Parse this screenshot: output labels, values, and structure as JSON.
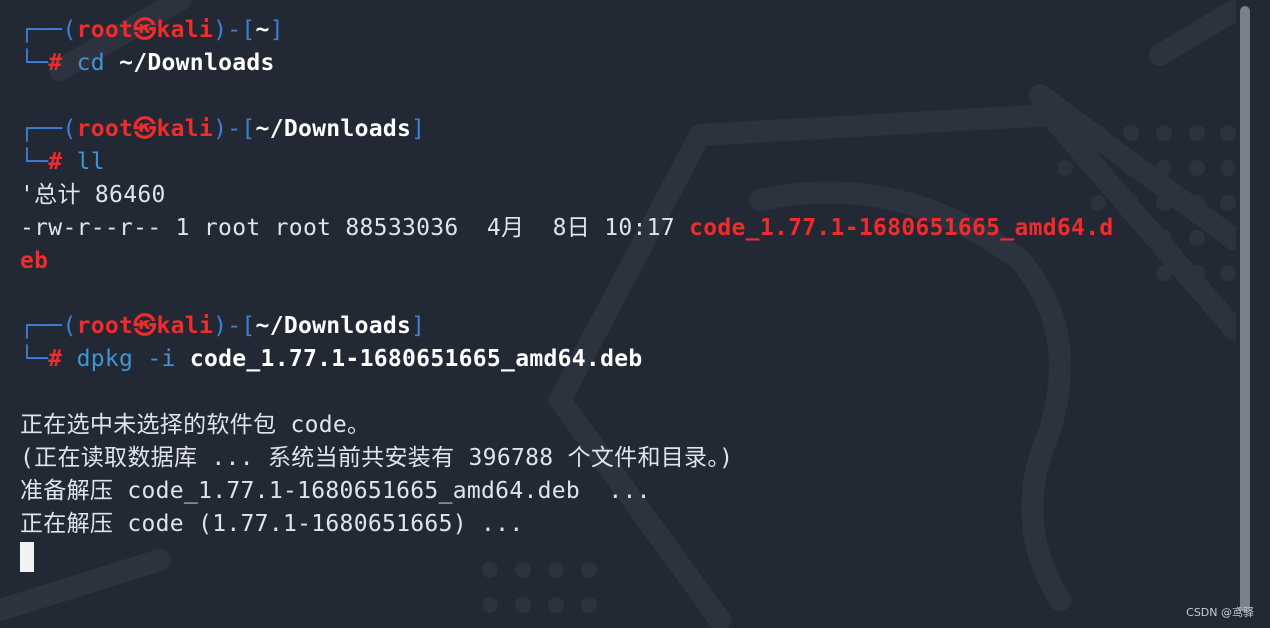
{
  "prompt": {
    "user": "root",
    "symbol": "㉿",
    "host": "kali",
    "hash": "#"
  },
  "blocks": [
    {
      "cwd": "~",
      "command": "cd",
      "args": "~/Downloads"
    },
    {
      "cwd": "~/Downloads",
      "command": "ll",
      "output": [
        "'总计 86460",
        "-rw-r--r-- 1 root root 88533036  4月  8日 10:17 "
      ],
      "file_name_part1": "code_1.77.1-1680651665_amd64.d",
      "file_name_part2": "eb"
    },
    {
      "cwd": "~/Downloads",
      "command": "dpkg",
      "option": "-i",
      "args": "code_1.77.1-1680651665_amd64.deb",
      "output": [
        "正在选中未选择的软件包 code。",
        "(正在读取数据库 ... 系统当前共安装有 396788 个文件和目录。)",
        "准备解压 code_1.77.1-1680651665_amd64.deb  ...",
        "正在解压 code (1.77.1-1680651665) ..."
      ]
    }
  ],
  "credit": "CSDN @鸢驿",
  "colors": {
    "background": "#232934",
    "user_host": "#ef2b2b",
    "prompt_box": "#3f7fd8",
    "command": "#3f95d4"
  }
}
